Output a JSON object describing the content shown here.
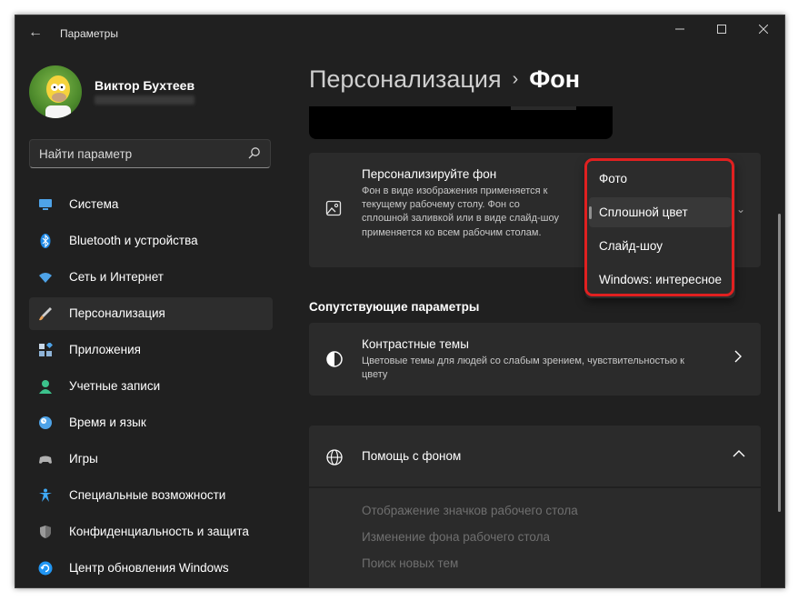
{
  "window": {
    "title": "Параметры"
  },
  "user": {
    "name": "Виктор Бухтеев"
  },
  "search": {
    "placeholder": "Найти параметр"
  },
  "sidebar": {
    "items": [
      {
        "label": "Система",
        "icon": "system-icon",
        "color": "#4ea3e8"
      },
      {
        "label": "Bluetooth и устройства",
        "icon": "bluetooth-icon",
        "color": "#1e88e5"
      },
      {
        "label": "Сеть и Интернет",
        "icon": "network-icon",
        "color": "#4ea3e8"
      },
      {
        "label": "Персонализация",
        "icon": "brush-icon",
        "color": "#e8a25a",
        "active": true
      },
      {
        "label": "Приложения",
        "icon": "apps-icon",
        "color": "#8fb4d8"
      },
      {
        "label": "Учетные записи",
        "icon": "account-icon",
        "color": "#3cc28c"
      },
      {
        "label": "Время и язык",
        "icon": "clock-globe-icon",
        "color": "#4ea3e8"
      },
      {
        "label": "Игры",
        "icon": "gamepad-icon",
        "color": "#a0a0a0"
      },
      {
        "label": "Специальные возможности",
        "icon": "accessibility-icon",
        "color": "#3fa9f5"
      },
      {
        "label": "Конфиденциальность и защита",
        "icon": "shield-icon",
        "color": "#9a9a9a"
      },
      {
        "label": "Центр обновления Windows",
        "icon": "update-icon",
        "color": "#2196f3"
      }
    ]
  },
  "breadcrumb": {
    "parent": "Персонализация",
    "current": "Фон"
  },
  "background_card": {
    "title": "Персонализируйте фон",
    "description": "Фон в виде изображения применяется к текущему рабочему столу. Фон со сплошной заливкой или в виде слайд-шоу применяется ко всем рабочим столам."
  },
  "dropdown": {
    "options": [
      "Фото",
      "Сплошной цвет",
      "Слайд-шоу",
      "Windows: интересное"
    ],
    "selected": "Сплошной цвет"
  },
  "related": {
    "header": "Сопутствующие параметры",
    "contrast_title": "Контрастные темы",
    "contrast_desc": "Цветовые темы для людей со слабым зрением, чувствительностью к цвету"
  },
  "help": {
    "title": "Помощь с фоном",
    "links": [
      "Отображение значков рабочего стола",
      "Изменение фона рабочего стола",
      "Поиск новых тем"
    ]
  },
  "colors": {
    "window_bg": "#202020",
    "card_bg": "#2b2b2b",
    "highlight": "#e02020"
  }
}
